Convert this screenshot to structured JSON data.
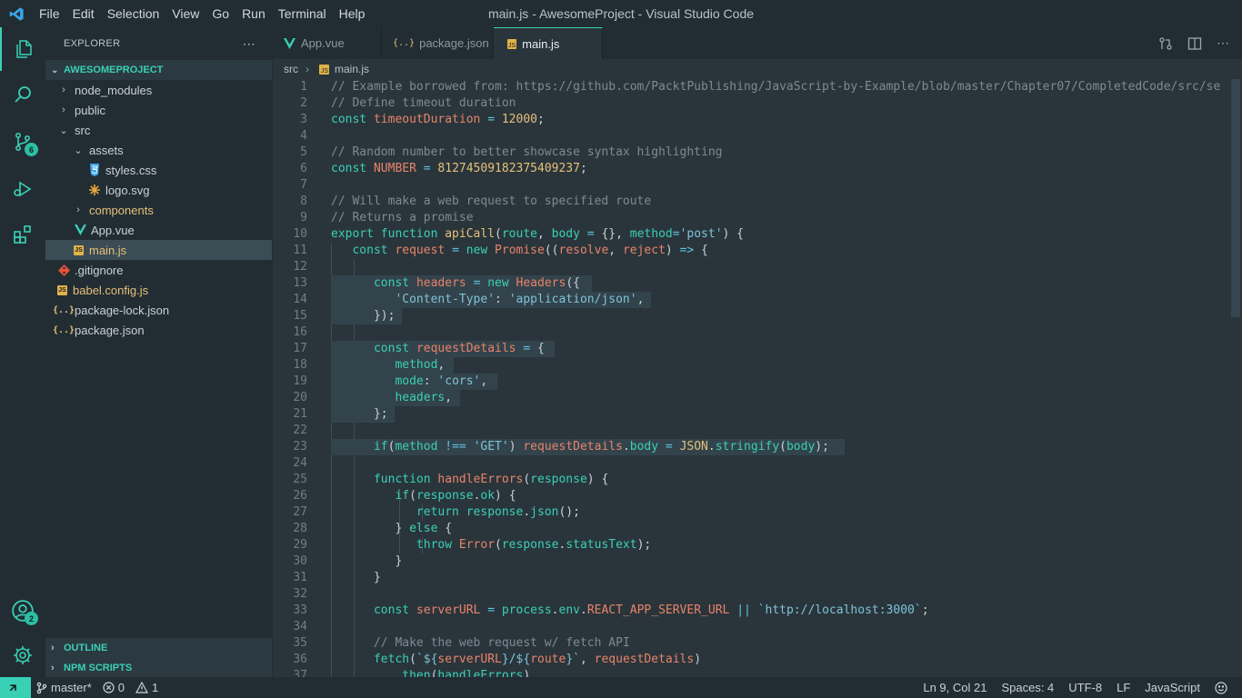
{
  "window": {
    "title": "main.js - AwesomeProject - Visual Studio Code"
  },
  "menu": [
    "File",
    "Edit",
    "Selection",
    "View",
    "Go",
    "Run",
    "Terminal",
    "Help"
  ],
  "activity_bar": {
    "items": [
      "explorer-icon",
      "search-icon",
      "source-control-icon",
      "run-debug-icon",
      "extensions-icon"
    ],
    "source_control_badge": "6",
    "accounts_badge": "2"
  },
  "sidebar": {
    "title": "EXPLORER",
    "more_label": "⋯",
    "project": "AWESOMEPROJECT",
    "tree": [
      {
        "label": "node_modules",
        "depth": 1,
        "kind": "folder-closed"
      },
      {
        "label": "public",
        "depth": 1,
        "kind": "folder-closed"
      },
      {
        "label": "src",
        "depth": 1,
        "kind": "folder-open"
      },
      {
        "label": "assets",
        "depth": 2,
        "kind": "folder-open"
      },
      {
        "label": "styles.css",
        "depth": 3,
        "kind": "css"
      },
      {
        "label": "logo.svg",
        "depth": 3,
        "kind": "svg"
      },
      {
        "label": "components",
        "depth": 2,
        "kind": "folder-closed"
      },
      {
        "label": "App.vue",
        "depth": 2,
        "kind": "vue"
      },
      {
        "label": "main.js",
        "depth": 2,
        "kind": "js",
        "selected": true
      },
      {
        "label": ".gitignore",
        "depth": 0,
        "kind": "git"
      },
      {
        "label": "babel.config.js",
        "depth": 0,
        "kind": "js"
      },
      {
        "label": "package-lock.json",
        "depth": 0,
        "kind": "json"
      },
      {
        "label": "package.json",
        "depth": 0,
        "kind": "json"
      }
    ],
    "sections": [
      "OUTLINE",
      "NPM SCRIPTS"
    ]
  },
  "tabs": [
    {
      "label": "App.vue",
      "kind": "vue"
    },
    {
      "label": "package.json",
      "kind": "json"
    },
    {
      "label": "main.js",
      "kind": "js",
      "active": true,
      "dirty": true
    }
  ],
  "breadcrumb": [
    "src",
    "main.js"
  ],
  "editor": {
    "line_numbers": [
      "1",
      "2",
      "3",
      "4",
      "5",
      "6",
      "7",
      "8",
      "9",
      "10",
      "11",
      "12",
      "13",
      "14",
      "15",
      "16",
      "17",
      "18",
      "19",
      "20",
      "21",
      "22",
      "23",
      "24",
      "25",
      "26",
      "27",
      "28",
      "29",
      "30",
      "31",
      "32",
      "33",
      "34",
      "35",
      "36",
      "37"
    ]
  },
  "statusbar": {
    "branch": "master*",
    "errors": "0",
    "warnings": "1",
    "position": "Ln 9, Col 21",
    "spaces": "Spaces: 4",
    "encoding": "UTF-8",
    "eol": "LF",
    "language": "JavaScript"
  },
  "colors": {
    "accent": "#3ad0b5",
    "background": "#2a353b",
    "sidebar": "#222d33"
  }
}
